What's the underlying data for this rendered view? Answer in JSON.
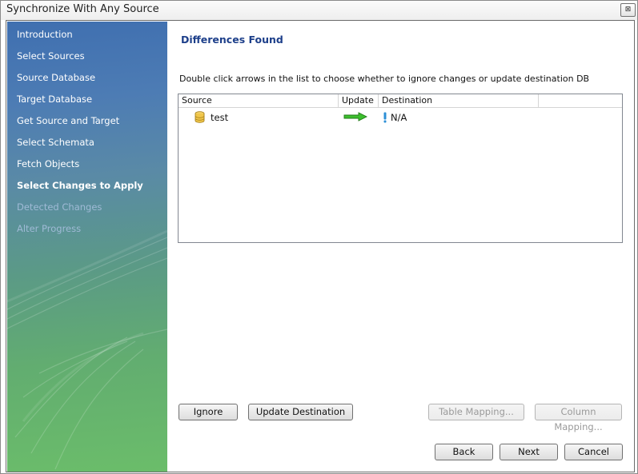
{
  "window": {
    "title": "Synchronize With Any Source",
    "close_glyph": "⊠"
  },
  "sidebar": {
    "items": [
      {
        "label": "Introduction",
        "state": "normal"
      },
      {
        "label": "Select Sources",
        "state": "normal"
      },
      {
        "label": "Source Database",
        "state": "normal"
      },
      {
        "label": "Target Database",
        "state": "normal"
      },
      {
        "label": "Get Source and Target",
        "state": "normal"
      },
      {
        "label": "Select Schemata",
        "state": "normal"
      },
      {
        "label": "Fetch Objects",
        "state": "normal"
      },
      {
        "label": "Select Changes to Apply",
        "state": "active"
      },
      {
        "label": "Detected Changes",
        "state": "disabled"
      },
      {
        "label": "Alter Progress",
        "state": "disabled"
      }
    ]
  },
  "main": {
    "heading": "Differences Found",
    "instruction": "Double click arrows in the list to choose whether to ignore changes or update destination DB",
    "list": {
      "columns": [
        "Source",
        "Update",
        "Destination"
      ],
      "rows": [
        {
          "source": "test",
          "source_icon": "database-icon",
          "update_icon": "arrow-right-icon",
          "destination": "N/A",
          "destination_icon": "exclamation-icon"
        }
      ]
    }
  },
  "actions": {
    "ignore": "Ignore",
    "update_destination": "Update Destination",
    "table_mapping": "Table Mapping...",
    "column_mapping": "Column Mapping..."
  },
  "footer": {
    "back": "Back",
    "next": "Next",
    "cancel": "Cancel"
  },
  "colors": {
    "heading": "#1d3f8a",
    "sidebar_top": "#3f6fb0",
    "sidebar_bottom": "#6bbd6a",
    "arrow": "#3dbf2e"
  }
}
